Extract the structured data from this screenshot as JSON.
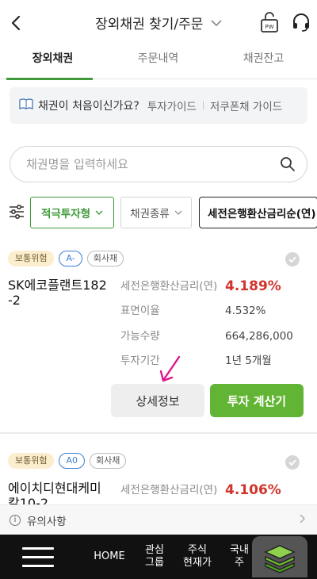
{
  "header": {
    "title": "장외채권 찾기/주문",
    "pw_label": "PW"
  },
  "tabs": [
    {
      "label": "장외채권",
      "active": true
    },
    {
      "label": "주문내역",
      "active": false
    },
    {
      "label": "채권잔고",
      "active": false
    }
  ],
  "guide": {
    "question": "채권이 처음이신가요?",
    "link1": "투자가이드",
    "link2": "저쿠폰채 가이드"
  },
  "search": {
    "placeholder": "채권명을 입력하세요"
  },
  "filters": {
    "risk_type": "적극투자형",
    "bond_type": "채권종류",
    "sort": "세전은행환산금리순(연)"
  },
  "bonds": [
    {
      "risk": "보통위험",
      "grade": "A-",
      "bond_type": "회사채",
      "name": "SK에코플랜트182-2",
      "rows": [
        {
          "label": "세전은행환산금리(연)",
          "value": "4.189%"
        },
        {
          "label": "표면이율",
          "value": "4.532%"
        },
        {
          "label": "가능수량",
          "value": "664,286,000"
        },
        {
          "label": "투자기간",
          "value": "1년 5개월"
        }
      ],
      "detail_button": "상세정보",
      "calc_button": "투자 계산기"
    },
    {
      "risk": "보통위험",
      "grade": "A0",
      "bond_type": "회사채",
      "name": "에이치디현대케미칼10-2",
      "rows": [
        {
          "label": "세전은행환산금리(연)",
          "value": "4.106%"
        }
      ]
    }
  ],
  "notice": {
    "label": "유의사항"
  },
  "bottom_nav": {
    "home": "HOME",
    "interest_1": "관심",
    "interest_2": "그룹",
    "stock_1": "주식",
    "stock_2": "현재가",
    "domestic_1": "국내",
    "domestic_2": "주"
  },
  "colors": {
    "accent_green": "#3f9a3a",
    "rate_red": "#d0342c",
    "calc_green": "#62b534"
  }
}
